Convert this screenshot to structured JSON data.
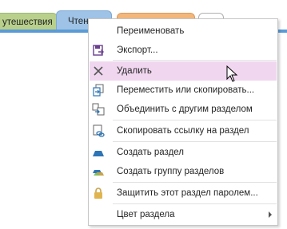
{
  "tabs": [
    {
      "label": "утешествия",
      "color": "#b8d08c"
    },
    {
      "label": "Чтен",
      "color": "#9fc3e6"
    },
    {
      "label": "",
      "color": "#f3b77c"
    },
    {
      "label": "",
      "color": "#ffffff"
    }
  ],
  "menu": {
    "items": [
      {
        "label": "Переименовать",
        "icon": "none"
      },
      {
        "label": "Экспорт...",
        "icon": "export-icon"
      },
      {
        "label": "Удалить",
        "icon": "delete-x-icon",
        "highlighted": true
      },
      {
        "label": "Переместить или скопировать...",
        "icon": "move-copy-icon"
      },
      {
        "label": "Объединить с другим разделом",
        "icon": "merge-icon"
      },
      {
        "label": "Скопировать ссылку на раздел",
        "icon": "link-icon"
      },
      {
        "label": "Создать раздел",
        "icon": "new-section-icon"
      },
      {
        "label": "Создать группу разделов",
        "icon": "new-section-group-icon"
      },
      {
        "label": "Защитить этот раздел паролем...",
        "icon": "lock-icon"
      },
      {
        "label": "Цвет раздела",
        "icon": "none",
        "submenu": true
      }
    ]
  },
  "colors": {
    "highlight": "#f0d6ef",
    "accent": "#5b9bd5"
  }
}
